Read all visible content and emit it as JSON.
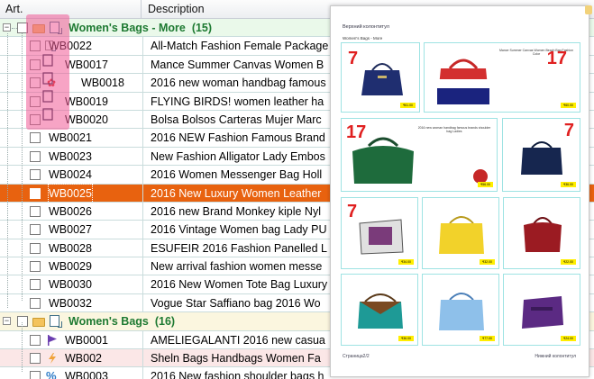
{
  "header": {
    "col_article": "Art.",
    "col_description": "Description"
  },
  "groups": [
    {
      "title": "Women's Bags - More",
      "count": "(15)"
    },
    {
      "title": "Women's Bags",
      "count": "(16)"
    }
  ],
  "rows": [
    {
      "code": "WB0022",
      "desc": "All-Match Fashion Female Package"
    },
    {
      "code": "WB0017",
      "desc": "Mance Summer Canvas Women B"
    },
    {
      "code": "WB0018",
      "desc": "2016 new woman handbag famous"
    },
    {
      "code": "WB0019",
      "desc": "FLYING BIRDS! women leather ha"
    },
    {
      "code": "WB0020",
      "desc": "Bolsa Bolsos Carteras Mujer Marc"
    },
    {
      "code": "WB0021",
      "desc": "2016 NEW Fashion Famous Brand"
    },
    {
      "code": "WB0023",
      "desc": "New Fashion Alligator Lady Embos"
    },
    {
      "code": "WB0024",
      "desc": "2016 Women Messenger Bag Holl"
    },
    {
      "code": "WB0025",
      "desc": "2016 New Luxury Women Leather"
    },
    {
      "code": "WB0026",
      "desc": "2016 new Brand Monkey kiple Nyl"
    },
    {
      "code": "WB0027",
      "desc": "2016 Vintage Women bag Lady PU"
    },
    {
      "code": "WB0028",
      "desc": "ESUFEIR 2016 Fashion Panelled L"
    },
    {
      "code": "WB0029",
      "desc": "New arrival fashion women messe"
    },
    {
      "code": "WB0030",
      "desc": "2016 New Women Tote Bag Luxury"
    },
    {
      "code": "WB0032",
      "desc": "Vogue Star Saffiano bag 2016 Wo"
    },
    {
      "code": "WB0001",
      "desc": "AMELIEGALANTI 2016 new casua"
    },
    {
      "code": "WB002",
      "desc": "Sheln Bags Handbags Women Fa"
    },
    {
      "code": "WB0003",
      "desc": "2016 New fashion shoulder bags h"
    }
  ],
  "preview": {
    "header_text": "Верхний колонтитул",
    "section_title": "Women's Bags - More",
    "footer_left": "Страница2/2",
    "footer_right": "Нижний колонтитул",
    "big_card_title": "Mance Summer Canvas Women Beach Bag Fashion Color",
    "mid_card_title": "2016 new woman handbag famous brands shoulder bag Ladies",
    "badge_mark": "7",
    "badge_mark_17": "17",
    "prices": [
      "₹61.00",
      "₹60.00",
      "₹56.00",
      "₹36.00",
      "₹34.00",
      "₹32.00",
      "₹22.00",
      "₹36.00",
      "₹77.00",
      "₹24.00"
    ]
  }
}
